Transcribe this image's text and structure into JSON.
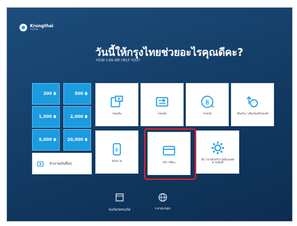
{
  "logo": {
    "line1": "Krungthai",
    "line2": "กรุงไทย"
  },
  "greeting": "วันนี้ให้กรุงไทยช่วยอะไรคุณดีคะ?",
  "subtitle": "HOW CAN WE HELP YOU?",
  "amounts": [
    "200 ฿",
    "500 ฿",
    "1,500 ฿",
    "2,000 ฿",
    "5,000 ฿",
    "20,000 ฿"
  ],
  "other_amount_label": "จำนวนเงินอื่นๆ",
  "services": [
    {
      "label": "ถอนเงิน",
      "icon": "withdraw-icon"
    },
    {
      "label": "โอนเงิน",
      "icon": "transfer-icon"
    },
    {
      "label": "จ่ายเงิน",
      "icon": "payment-icon"
    },
    {
      "label": "เติมเงิน / เติมเงินพร้อมเพย์",
      "icon": "topup-icon"
    },
    {
      "label": "สอบถาม",
      "icon": "inquiry-icon"
    },
    {
      "label": "บริการอื่นๆ",
      "icon": "other-services-icon"
    },
    {
      "label": "ตั้ง / ยกเลิกบริการพร้อมเพย์ผ่านบัญชี",
      "icon": "settings-icon"
    }
  ],
  "bottom": {
    "card_label": "ขอเปิดบัตรเดบิต",
    "language_label": "Language"
  },
  "colors": {
    "background": "#123a63",
    "amount_button": "#1b9be0",
    "highlight": "#d2232a"
  }
}
